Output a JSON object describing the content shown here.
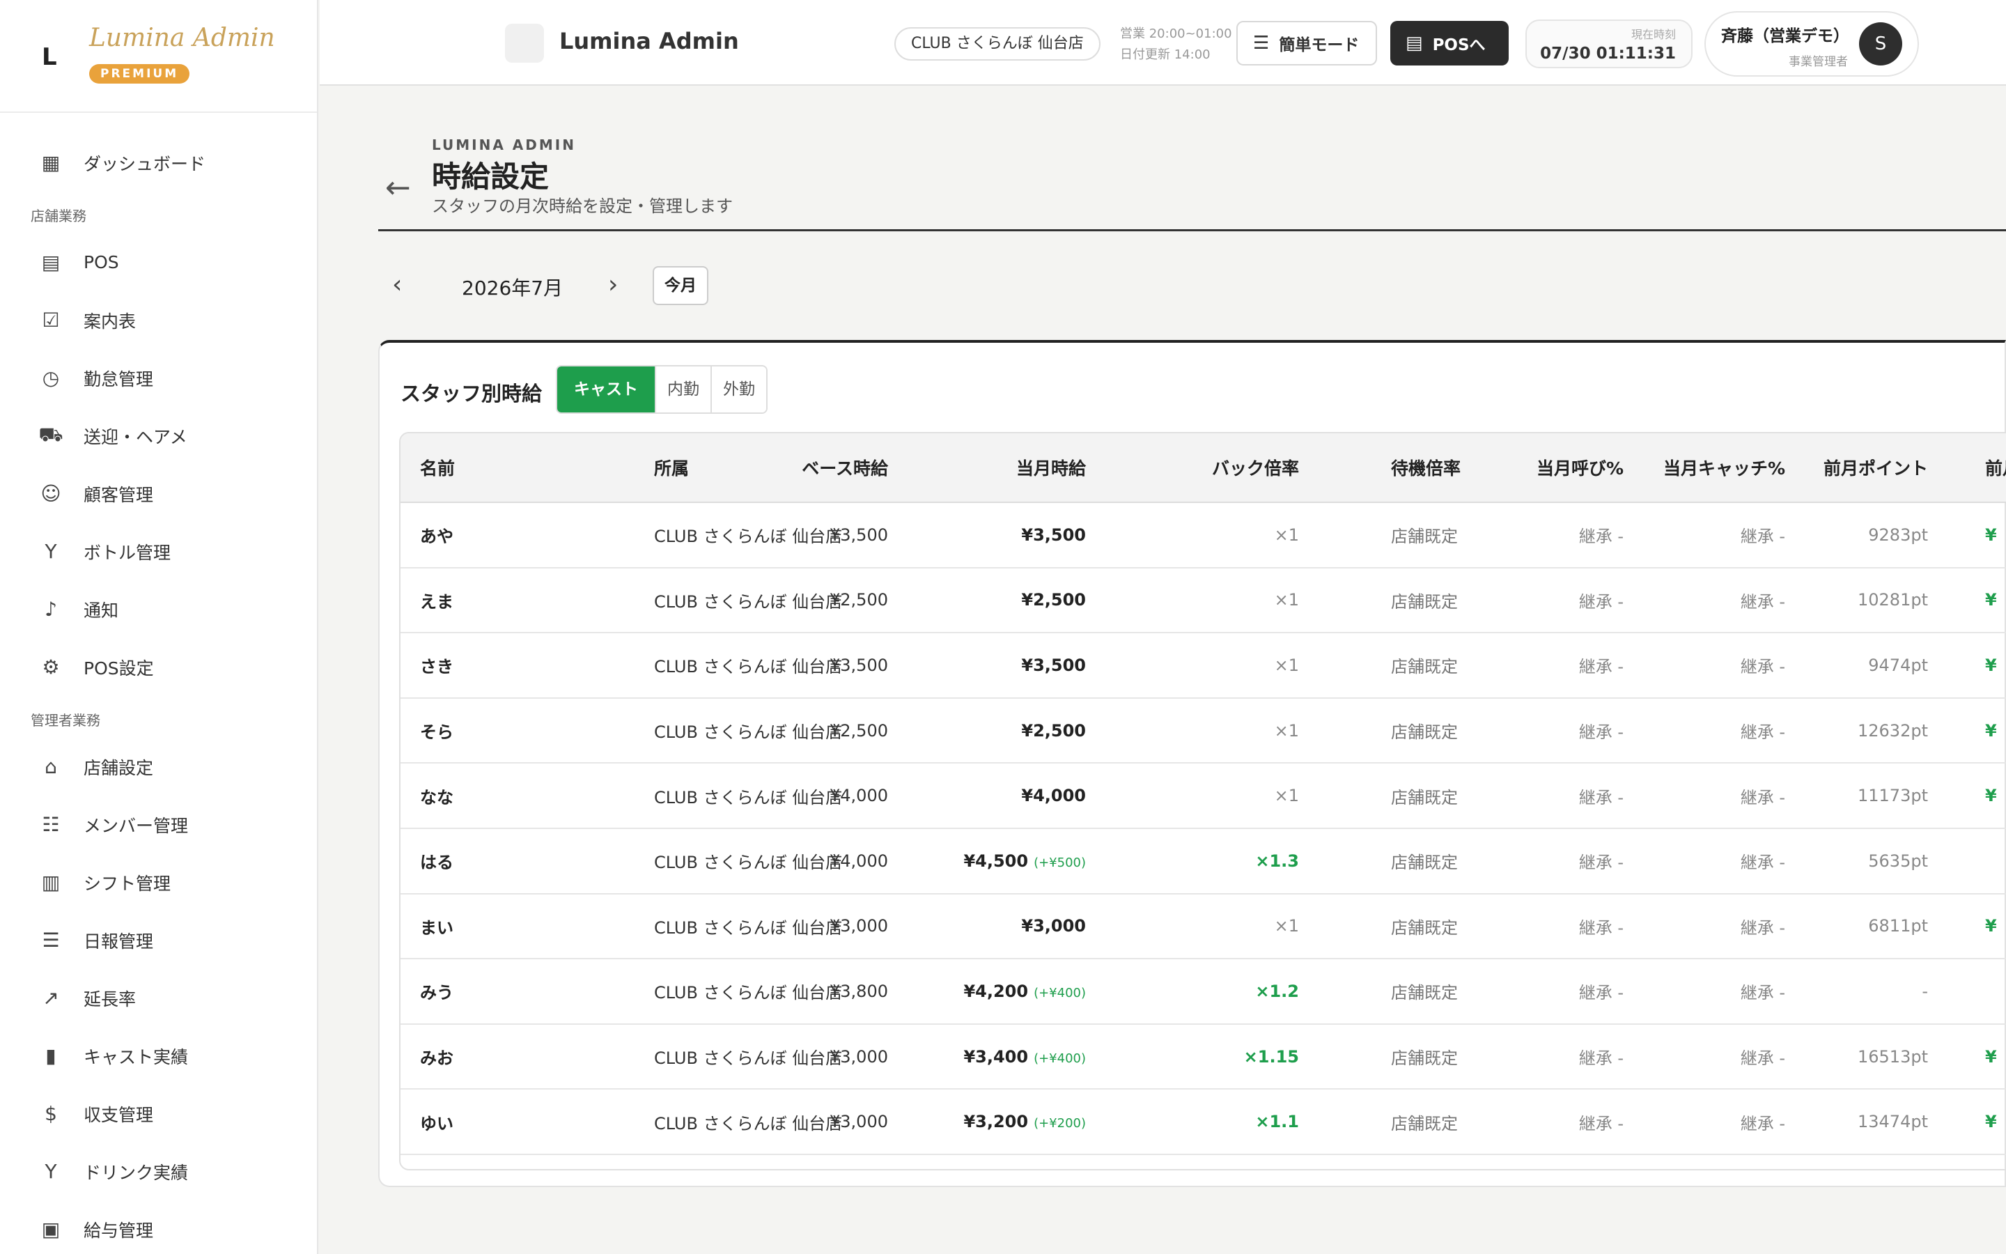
{
  "sidebar": {
    "brand_mark": "L",
    "brand_name": "Lumina Admin",
    "brand_badge": "PREMIUM",
    "top_items": [
      {
        "label": "ダッシュボード",
        "icon": "dashboard-icon"
      }
    ],
    "sections": [
      {
        "title": "店舗業務",
        "items": [
          {
            "label": "POS",
            "icon": "register-icon"
          },
          {
            "label": "案内表",
            "icon": "checklist-icon"
          },
          {
            "label": "勤怠管理",
            "icon": "clock-icon"
          },
          {
            "label": "送迎・ヘアメ",
            "icon": "bus-icon"
          },
          {
            "label": "顧客管理",
            "icon": "face-icon"
          },
          {
            "label": "ボトル管理",
            "icon": "glass-icon"
          },
          {
            "label": "通知",
            "icon": "bell-icon"
          },
          {
            "label": "POS設定",
            "icon": "gear-icon"
          }
        ]
      },
      {
        "title": "管理者業務",
        "items": [
          {
            "label": "店舗設定",
            "icon": "store-icon"
          },
          {
            "label": "メンバー管理",
            "icon": "people-icon"
          },
          {
            "label": "シフト管理",
            "icon": "calendar-icon"
          },
          {
            "label": "日報管理",
            "icon": "report-icon"
          },
          {
            "label": "延長率",
            "icon": "trend-icon"
          },
          {
            "label": "キャスト実績",
            "icon": "bar-chart-icon"
          },
          {
            "label": "収支管理",
            "icon": "dollar-icon"
          },
          {
            "label": "ドリンク実績",
            "icon": "glass-icon"
          },
          {
            "label": "給与管理",
            "icon": "payment-icon"
          }
        ]
      }
    ]
  },
  "topbar": {
    "title": "Lumina Admin",
    "store": "CLUB さくらんぼ 仙台店",
    "hours": "営業 20:00~01:00",
    "date_update": "日付更新 14:00",
    "simple_mode": "簡単モード",
    "pos_link": "POSへ",
    "clock_label": "現在時刻",
    "clock_value": "07/30 01:11:31",
    "user_name": "斉藤（営業デモ）",
    "user_role": "事業管理者",
    "user_initial": "S"
  },
  "page": {
    "brand": "LUMINA ADMIN",
    "title": "時給設定",
    "subtitle": "スタッフの月次時給を設定・管理します"
  },
  "month": {
    "label": "2026年7月",
    "today": "今月"
  },
  "card": {
    "title": "スタッフ別時給",
    "tabs": [
      "キャスト",
      "内勤",
      "外勤"
    ],
    "active_tab": 0
  },
  "table": {
    "headers": {
      "name": "名前",
      "affiliation": "所属",
      "base": "ベース時給",
      "current": "当月時給",
      "back": "バック倍率",
      "wait": "待機倍率",
      "call": "当月呼び%",
      "catch": "当月キャッチ%",
      "points": "前月ポイント",
      "prev": "前月"
    },
    "rows": [
      {
        "name": "あや",
        "affiliation": "CLUB さくらんぼ 仙台店",
        "base": "¥3,500",
        "current": "¥3,500",
        "delta": "",
        "back": "×1",
        "back_up": false,
        "wait": "店舗既定",
        "call": "継承 -",
        "catch": "継承 -",
        "points": "9283pt",
        "prev": "¥"
      },
      {
        "name": "えま",
        "affiliation": "CLUB さくらんぼ 仙台店",
        "base": "¥2,500",
        "current": "¥2,500",
        "delta": "",
        "back": "×1",
        "back_up": false,
        "wait": "店舗既定",
        "call": "継承 -",
        "catch": "継承 -",
        "points": "10281pt",
        "prev": "¥"
      },
      {
        "name": "さき",
        "affiliation": "CLUB さくらんぼ 仙台店",
        "base": "¥3,500",
        "current": "¥3,500",
        "delta": "",
        "back": "×1",
        "back_up": false,
        "wait": "店舗既定",
        "call": "継承 -",
        "catch": "継承 -",
        "points": "9474pt",
        "prev": "¥"
      },
      {
        "name": "そら",
        "affiliation": "CLUB さくらんぼ 仙台店",
        "base": "¥2,500",
        "current": "¥2,500",
        "delta": "",
        "back": "×1",
        "back_up": false,
        "wait": "店舗既定",
        "call": "継承 -",
        "catch": "継承 -",
        "points": "12632pt",
        "prev": "¥"
      },
      {
        "name": "なな",
        "affiliation": "CLUB さくらんぼ 仙台店",
        "base": "¥4,000",
        "current": "¥4,000",
        "delta": "",
        "back": "×1",
        "back_up": false,
        "wait": "店舗既定",
        "call": "継承 -",
        "catch": "継承 -",
        "points": "11173pt",
        "prev": "¥"
      },
      {
        "name": "はる",
        "affiliation": "CLUB さくらんぼ 仙台店",
        "base": "¥4,000",
        "current": "¥4,500",
        "delta": "(+¥500)",
        "back": "×1.3",
        "back_up": true,
        "wait": "店舗既定",
        "call": "継承 -",
        "catch": "継承 -",
        "points": "5635pt",
        "prev": ""
      },
      {
        "name": "まい",
        "affiliation": "CLUB さくらんぼ 仙台店",
        "base": "¥3,000",
        "current": "¥3,000",
        "delta": "",
        "back": "×1",
        "back_up": false,
        "wait": "店舗既定",
        "call": "継承 -",
        "catch": "継承 -",
        "points": "6811pt",
        "prev": "¥"
      },
      {
        "name": "みう",
        "affiliation": "CLUB さくらんぼ 仙台店",
        "base": "¥3,800",
        "current": "¥4,200",
        "delta": "(+¥400)",
        "back": "×1.2",
        "back_up": true,
        "wait": "店舗既定",
        "call": "継承 -",
        "catch": "継承 -",
        "points": "-",
        "prev": ""
      },
      {
        "name": "みお",
        "affiliation": "CLUB さくらんぼ 仙台店",
        "base": "¥3,000",
        "current": "¥3,400",
        "delta": "(+¥400)",
        "back": "×1.15",
        "back_up": true,
        "wait": "店舗既定",
        "call": "継承 -",
        "catch": "継承 -",
        "points": "16513pt",
        "prev": "¥"
      },
      {
        "name": "ゆい",
        "affiliation": "CLUB さくらんぼ 仙台店",
        "base": "¥3,000",
        "current": "¥3,200",
        "delta": "(+¥200)",
        "back": "×1.1",
        "back_up": true,
        "wait": "店舗既定",
        "call": "継承 -",
        "catch": "継承 -",
        "points": "13474pt",
        "prev": "¥"
      }
    ]
  },
  "colors": {
    "accent_green": "#1e9e4c",
    "dark": "#2b2b2b",
    "brand_gold": "#c9a25a",
    "badge_orange": "#e9a23b"
  }
}
